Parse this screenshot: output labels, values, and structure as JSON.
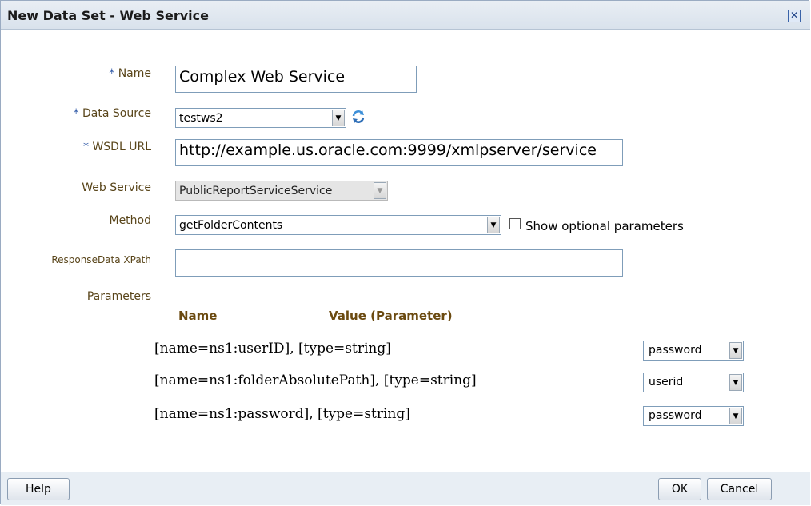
{
  "dialog": {
    "title": "New Data Set - Web Service",
    "close_symbol": "✕"
  },
  "form": {
    "name_label": "Name",
    "name_value": "Complex Web Service",
    "data_source_label": "Data Source",
    "data_source_value": "testws2",
    "wsdl_label": "WSDL URL",
    "wsdl_value": "http://example.us.oracle.com:9999/xmlpserver/service",
    "web_service_label": "Web Service",
    "web_service_value": "PublicReportServiceService",
    "method_label": "Method",
    "method_value": "getFolderContents",
    "show_optional_label": "Show optional parameters",
    "response_xpath_label": "ResponseData XPath",
    "response_xpath_value": "",
    "parameters_label": "Parameters",
    "required_marker": "*"
  },
  "parameters": {
    "col_name": "Name",
    "col_value": "Value (Parameter)",
    "rows": [
      {
        "name": "[name=ns1:userID], [type=string]",
        "value": "password"
      },
      {
        "name": "[name=ns1:folderAbsolutePath], [type=string]",
        "value": "userid"
      },
      {
        "name": "[name=ns1:password], [type=string]",
        "value": "password"
      }
    ]
  },
  "buttons": {
    "help": "Help",
    "ok": "OK",
    "cancel": "Cancel"
  },
  "icons": {
    "close": "close-icon",
    "refresh": "refresh-icon",
    "dropdown": "chevron-down-icon"
  },
  "colors": {
    "label": "#59451a",
    "required": "#2d57a6",
    "header": "#6b4a10"
  }
}
